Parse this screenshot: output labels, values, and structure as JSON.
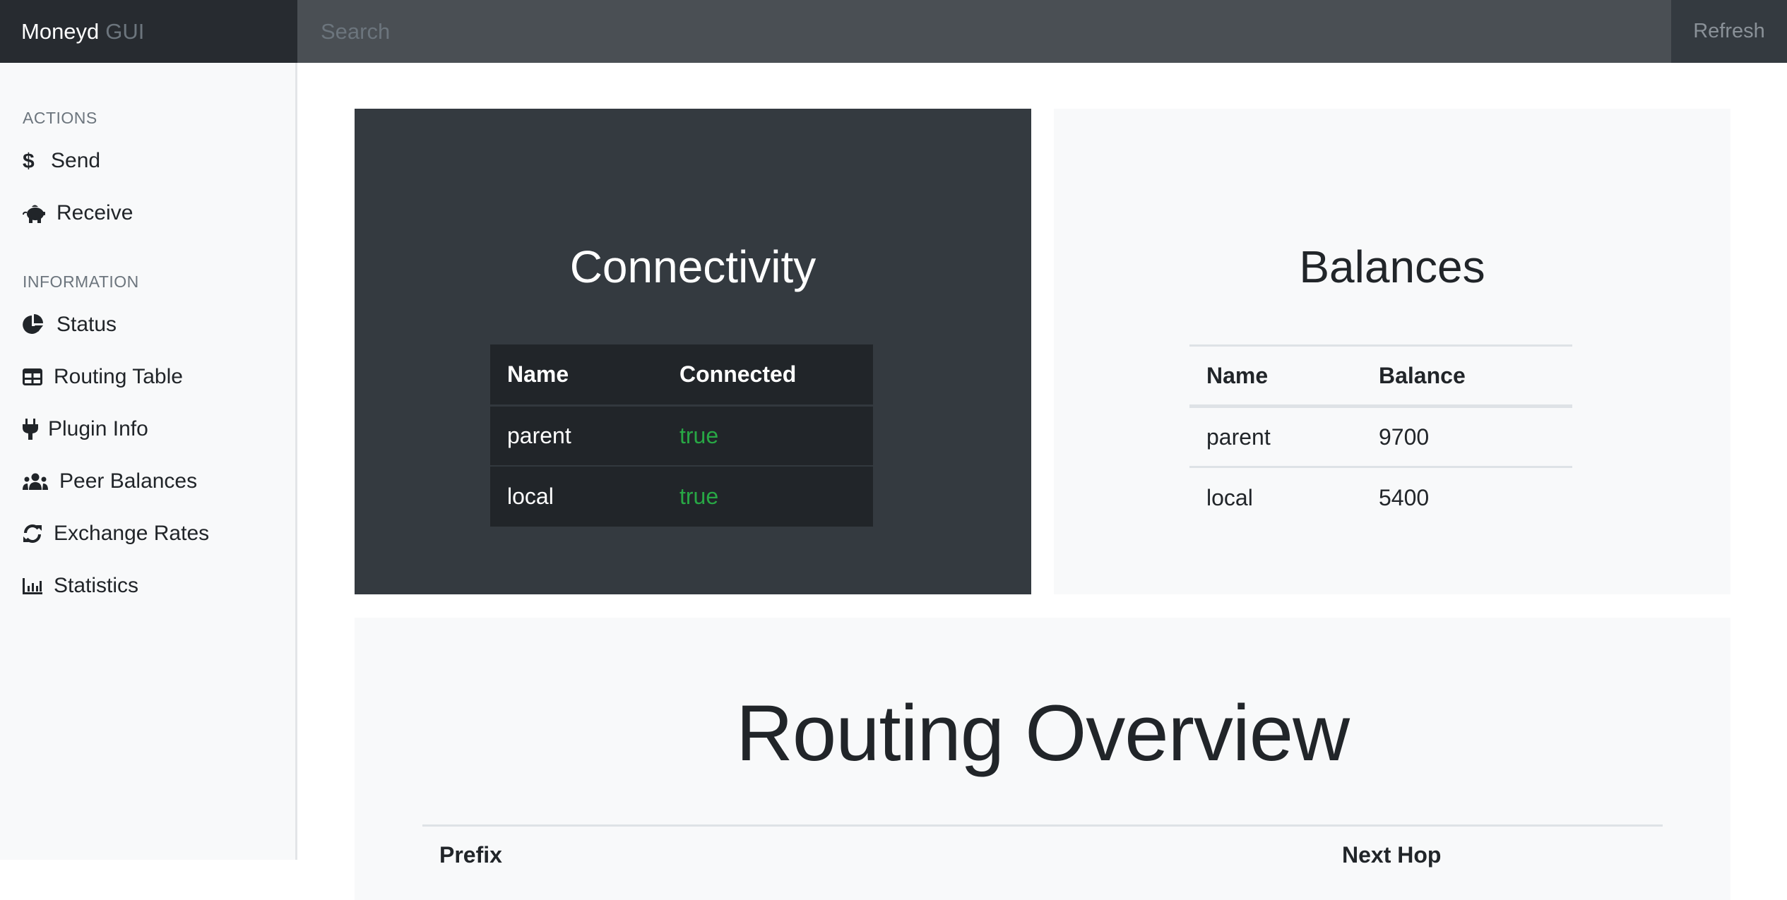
{
  "header": {
    "brand": "Moneyd",
    "brand_suffix": "GUI",
    "search_placeholder": "Search",
    "refresh_label": "Refresh"
  },
  "sidebar": {
    "sections": [
      {
        "heading": "ACTIONS",
        "items": [
          {
            "label": "Send",
            "icon": "dollar-icon"
          },
          {
            "label": "Receive",
            "icon": "piggy-bank-icon"
          }
        ]
      },
      {
        "heading": "INFORMATION",
        "items": [
          {
            "label": "Status",
            "icon": "pie-chart-icon"
          },
          {
            "label": "Routing Table",
            "icon": "table-icon"
          },
          {
            "label": "Plugin Info",
            "icon": "plug-icon"
          },
          {
            "label": "Peer Balances",
            "icon": "users-icon"
          },
          {
            "label": "Exchange Rates",
            "icon": "sync-icon"
          },
          {
            "label": "Statistics",
            "icon": "bar-chart-icon"
          }
        ]
      }
    ]
  },
  "connectivity": {
    "title": "Connectivity",
    "columns": [
      "Name",
      "Connected"
    ],
    "rows": [
      {
        "name": "parent",
        "connected": "true"
      },
      {
        "name": "local",
        "connected": "true"
      }
    ],
    "ok_color": "#28a745"
  },
  "balances": {
    "title": "Balances",
    "columns": [
      "Name",
      "Balance"
    ],
    "rows": [
      {
        "name": "parent",
        "balance": "9700"
      },
      {
        "name": "local",
        "balance": "5400"
      }
    ]
  },
  "routing": {
    "title": "Routing Overview",
    "columns": [
      "Prefix",
      "Next Hop"
    ]
  }
}
